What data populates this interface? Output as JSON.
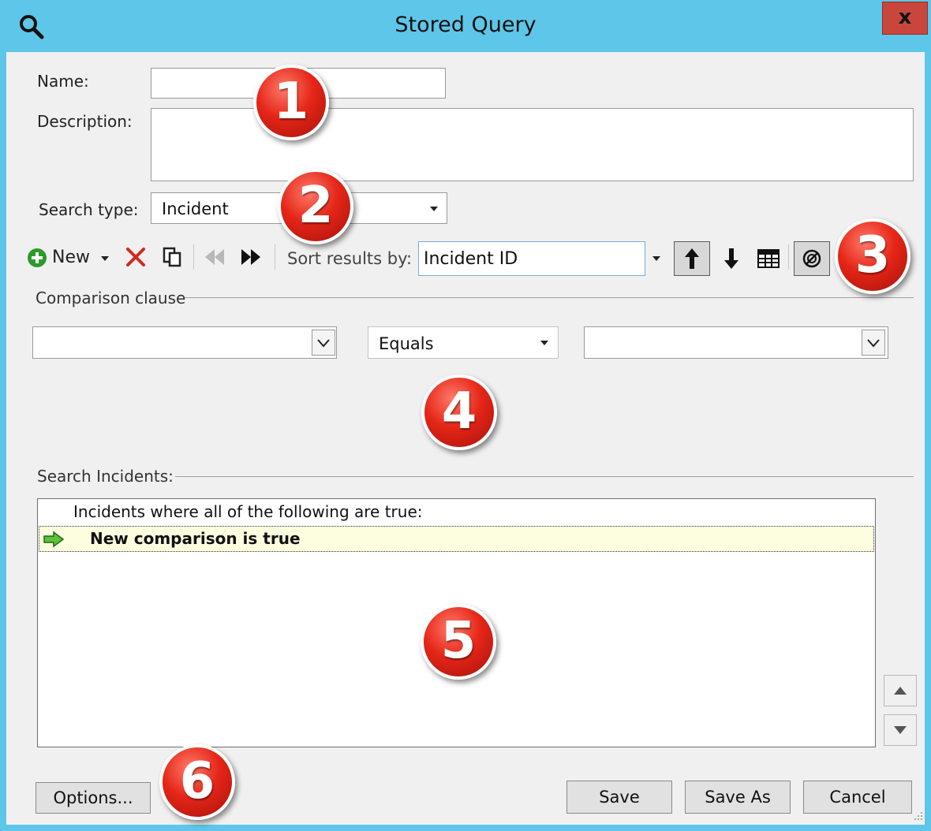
{
  "window": {
    "title": "Stored Query",
    "close_label": "x"
  },
  "form": {
    "name_label": "Name:",
    "name_value": "",
    "description_label": "Description:",
    "description_value": "",
    "search_type_label": "Search type:",
    "search_type_value": "Incident"
  },
  "toolbar": {
    "new_label": "New",
    "sort_label": "Sort results by:",
    "sort_value": "Incident ID"
  },
  "comparison": {
    "section_label": "Comparison clause",
    "field_value": "",
    "operator_value": "Equals",
    "value_value": ""
  },
  "search": {
    "section_label": "Search Incidents:",
    "header_text": "Incidents where all of the following are true:",
    "rows": [
      {
        "text": "New comparison is true"
      }
    ]
  },
  "buttons": {
    "options": "Options...",
    "save": "Save",
    "save_as": "Save As",
    "cancel": "Cancel"
  },
  "callouts": [
    "1",
    "2",
    "3",
    "4",
    "5",
    "6"
  ],
  "colors": {
    "titlebar": "#5ec6e8",
    "close": "#c9463d",
    "badge": "#e52618",
    "highlight_row": "#fdfde0"
  }
}
